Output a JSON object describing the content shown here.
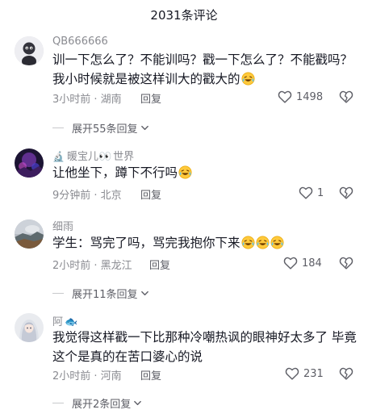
{
  "header": {
    "title": "2031条评论"
  },
  "comments": [
    {
      "username": "QB666666",
      "text": "训一下怎么了？不能训吗？戳一下怎么了？不能戳吗？我小时候就是被这样训大的戳大的",
      "emoji_count": 1,
      "time_location": "3小时前 · 湖南",
      "reply_label": "回复",
      "likes": "1498",
      "expand_label": "展开55条回复"
    },
    {
      "username_prefix_icon": "microscope",
      "username": "暖宝儿",
      "username_glyph": "👀",
      "username_tail": "世界",
      "text": "让他坐下，蹲下不行吗",
      "emoji_count": 1,
      "time_location": "9分钟前 · 北京",
      "reply_label": "回复",
      "likes": "1"
    },
    {
      "username": "细雨",
      "text": "学生：骂完了吗，骂完我抱你下来",
      "emoji_count": 3,
      "time_location": "2小时前 · 黑龙江",
      "reply_label": "回复",
      "likes": "184",
      "expand_label": "展开11条回复"
    },
    {
      "username": "阿",
      "username_glyph": "🐟",
      "text": "我觉得这样戳一下比那种冷嘲热讽的眼神好太多了 毕竟这个是真的在苦口婆心的说",
      "emoji_count": 0,
      "time_location": "2小时前 · 河南",
      "reply_label": "回复",
      "likes": "231",
      "expand_label": "展开2条回复"
    }
  ],
  "colors": {
    "text_primary": "#161823",
    "text_secondary": "#8a8b91",
    "reply": "#5d5e66",
    "emoji_face": "#ffc93c"
  },
  "icons": {
    "like": "heart-outline-icon",
    "dislike": "broken-heart-icon",
    "expand": "chevron-down-icon",
    "emoji": "laughing-crying-emoji-icon"
  }
}
